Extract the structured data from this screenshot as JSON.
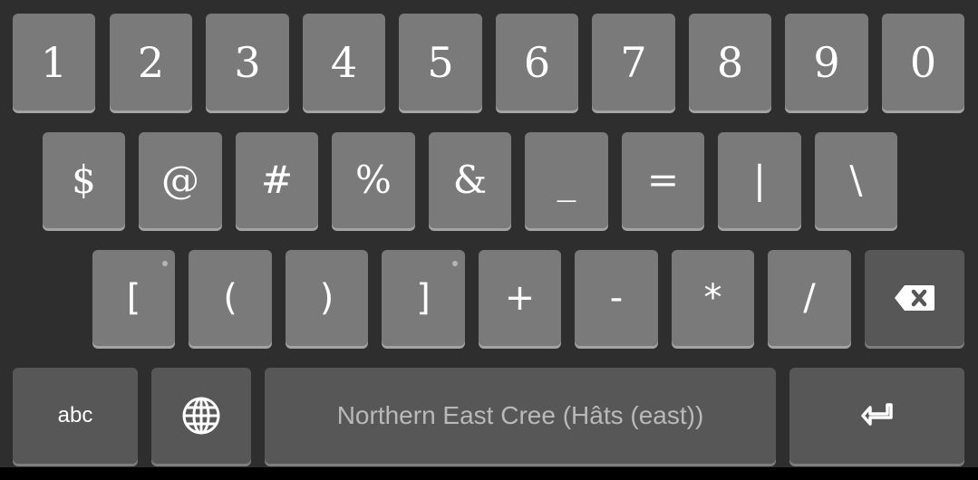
{
  "keyboard": {
    "row1": [
      "1",
      "2",
      "3",
      "4",
      "5",
      "6",
      "7",
      "8",
      "9",
      "0"
    ],
    "row2": [
      "$",
      "@",
      "#",
      "%",
      "&",
      "_",
      "=",
      "|",
      "\\"
    ],
    "row3": [
      "[",
      "(",
      ")",
      "]",
      "+",
      "-",
      "*",
      "/"
    ],
    "mode_switch_label": "abc",
    "spacebar_label": "Northern East Cree (Hâts (east))",
    "icons": {
      "backspace": "backspace-icon",
      "globe": "globe-icon",
      "enter": "enter-icon"
    },
    "colors": {
      "background": "#2e2e2e",
      "key": "#7a7a7a",
      "key_dark": "#575757",
      "text": "#ffffff"
    }
  }
}
